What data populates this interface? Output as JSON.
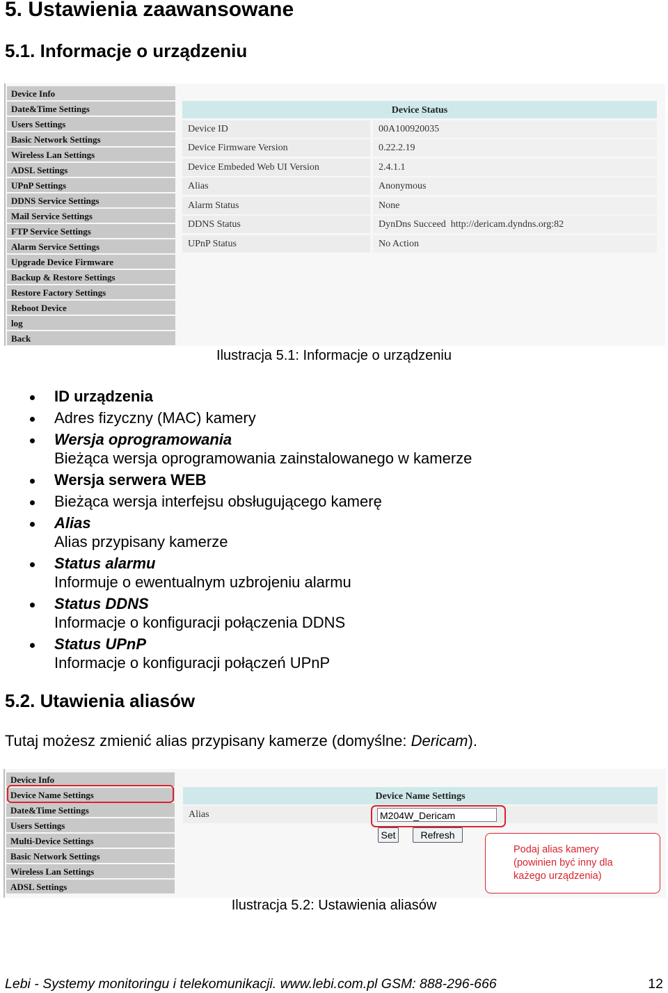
{
  "heading1": "5. Ustawienia zaawansowane",
  "heading2": "5.1. Informacje o urządzeniu",
  "fig1": {
    "menu": [
      "Device Info",
      "Date&Time Settings",
      "Users Settings",
      "Basic Network Settings",
      "Wireless Lan Settings",
      "ADSL Settings",
      "UPnP Settings",
      "DDNS Service Settings",
      "Mail Service Settings",
      "FTP Service Settings",
      "Alarm Service Settings",
      "Upgrade Device Firmware",
      "Backup & Restore Settings",
      "Restore Factory Settings",
      "Reboot Device",
      "log",
      "Back"
    ],
    "title": "Device Status",
    "rows": [
      {
        "label": "Device ID",
        "value": "00A100920035"
      },
      {
        "label": "Device Firmware Version",
        "value": "0.22.2.19"
      },
      {
        "label": "Device Embeded Web UI Version",
        "value": "2.4.1.1"
      },
      {
        "label": "Alias",
        "value": "Anonymous"
      },
      {
        "label": "Alarm Status",
        "value": "None"
      },
      {
        "label": "DDNS Status",
        "value": "DynDns Succeed  http://dericam.dyndns.org:82"
      },
      {
        "label": "UPnP Status",
        "value": "No Action"
      }
    ],
    "caption": "Ilustracja 5.1: Informacje o urządzeniu"
  },
  "bullets": [
    {
      "title": "ID urządzenia",
      "style": "bold",
      "desc": ""
    },
    {
      "title": "Adres fizyczny (MAC) kamery",
      "style": "normal",
      "desc": ""
    },
    {
      "title": "Wersja oprogramowania",
      "style": "bolditalic",
      "desc": "Bieżąca wersja oprogramowania zainstalowanego w kamerze"
    },
    {
      "title": "Wersja serwera WEB",
      "style": "bold",
      "desc": ""
    },
    {
      "title": "Bieżąca wersja interfejsu obsługującego kamerę",
      "style": "normal",
      "desc": ""
    },
    {
      "title": "Alias",
      "style": "bolditalic",
      "desc": "Alias przypisany kamerze"
    },
    {
      "title": "Status alarmu",
      "style": "bolditalic",
      "desc": "Informuje o ewentualnym uzbrojeniu alarmu"
    },
    {
      "title": "Status DDNS",
      "style": "bolditalic",
      "desc": "Informacje o konfiguracji połączenia DDNS"
    },
    {
      "title": "Status UPnP",
      "style": "bolditalic",
      "desc": "Informacje o konfiguracji połączeń UPnP"
    }
  ],
  "heading3": "5.2. Utawienia aliasów",
  "para": {
    "text": "Tutaj możesz zmienić alias przypisany kamerze (domyślne: ",
    "italic": "Dericam",
    "end": ")."
  },
  "fig2": {
    "menu": [
      "Device Info",
      "Device Name Settings",
      "Date&Time Settings",
      "Users Settings",
      "Multi-Device Settings",
      "Basic Network Settings",
      "Wireless Lan Settings",
      "ADSL Settings"
    ],
    "title": "Device Name Settings",
    "alias_label": "Alias",
    "alias_value": "M204W_Dericam",
    "set": "Set",
    "refresh": "Refresh",
    "note": "Podaj alias kamery (powinien być inny dla każego urządzenia)",
    "highlight_color": "#d9232e",
    "caption": "Ilustracja 5.2: Ustawienia aliasów"
  },
  "footer": {
    "text": "Lebi - Systemy monitoringu i telekomunikacji. www.lebi.com.pl GSM: 888-296-666",
    "page": "12"
  }
}
